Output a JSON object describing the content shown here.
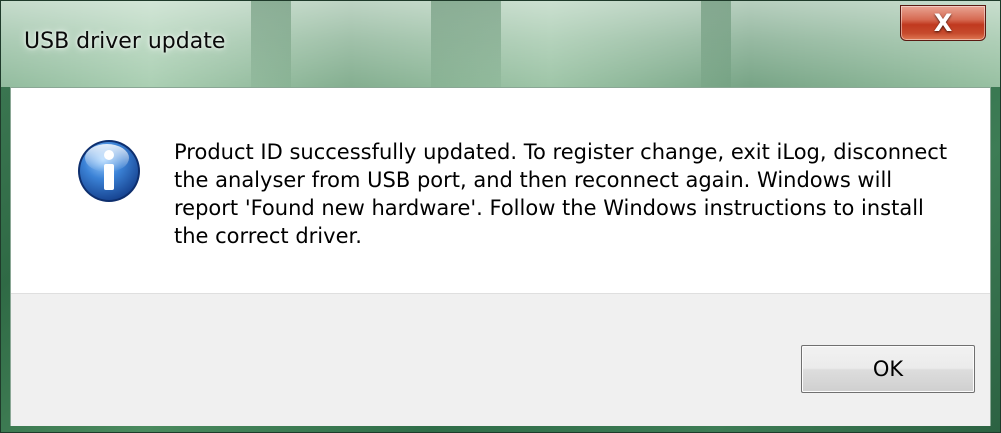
{
  "window": {
    "title": "USB driver update",
    "close_glyph": "X"
  },
  "dialog": {
    "icon": "information-icon",
    "message": "Product ID successfully updated. To register change, exit iLog, disconnect the analyser from USB port, and then reconnect again. Windows will report 'Found new hardware'. Follow the Windows instructions to install the correct driver.",
    "ok_label": "OK"
  },
  "colors": {
    "close_button": "#c64a2c",
    "info_icon_blue": "#1f5fb8",
    "button_area": "#f0f0f0"
  }
}
